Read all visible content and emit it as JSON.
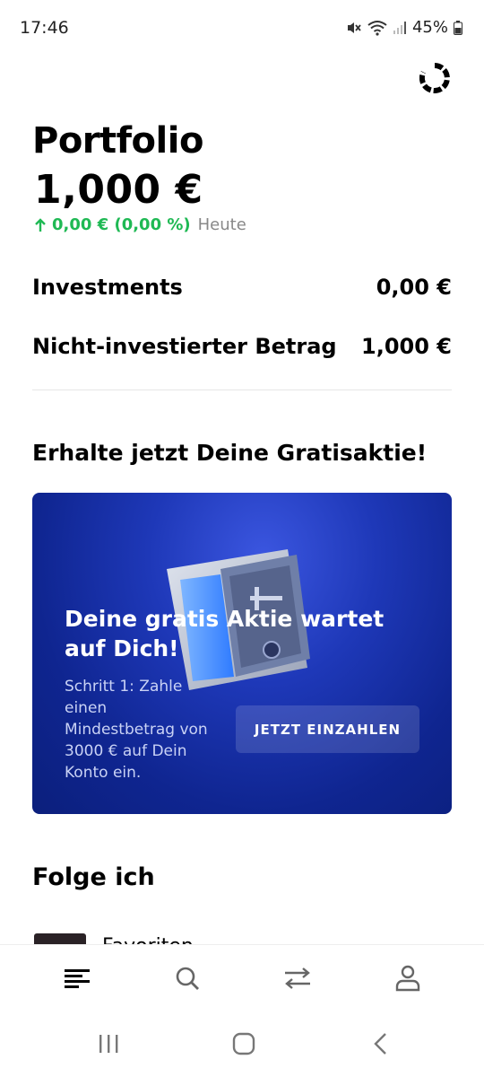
{
  "status_bar": {
    "time": "17:46",
    "battery": "45%"
  },
  "portfolio": {
    "title": "Portfolio",
    "total": "1,000 €",
    "change": "0,00 € (0,00 %)",
    "change_period": "Heute"
  },
  "summary": [
    {
      "label": "Investments",
      "value": "0,00 €"
    },
    {
      "label": "Nicht-investierter Betrag",
      "value": "1,000 €"
    }
  ],
  "promo": {
    "heading": "Erhalte jetzt Deine Gratisaktie!",
    "title": "Deine gratis Aktie wartet auf Dich!",
    "text": "Schritt 1: Zahle einen Mindestbetrag von 3000 € auf Dein Konto ein.",
    "button": "JETZT EINZAHLEN"
  },
  "follow": {
    "heading": "Folge ich",
    "items": [
      {
        "label": "Favoriten"
      }
    ]
  },
  "tabs": [
    {
      "icon": "portfolio-lines-icon"
    },
    {
      "icon": "search-icon"
    },
    {
      "icon": "transfer-arrows-icon"
    },
    {
      "icon": "profile-icon"
    }
  ],
  "colors": {
    "positive": "#1fb954",
    "promo_bg": "#1e38b8",
    "text": "#000000"
  }
}
